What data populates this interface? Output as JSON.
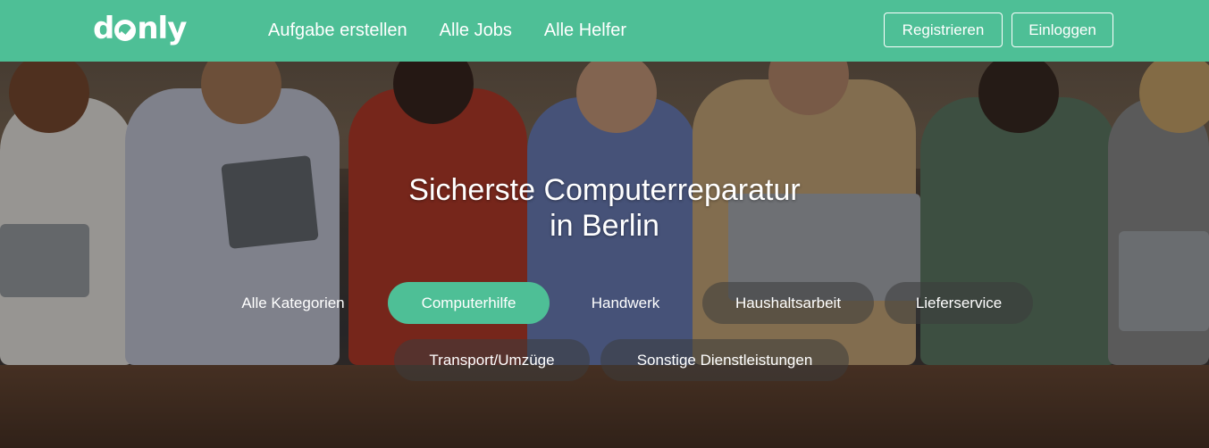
{
  "logo": {
    "text_pre": "d",
    "text_post": "nly",
    "icon": "check-circle-icon"
  },
  "nav": {
    "links": [
      "Aufgabe erstellen",
      "Alle Jobs",
      "Alle Helfer"
    ],
    "register_label": "Registrieren",
    "login_label": "Einloggen"
  },
  "hero": {
    "headline_line1": "Sicherste Computerreparatur",
    "headline_line2": "in Berlin"
  },
  "categories": [
    {
      "label": "Alle Kategorien",
      "state": "plain"
    },
    {
      "label": "Computerhilfe",
      "state": "active"
    },
    {
      "label": "Handwerk",
      "state": "plain"
    },
    {
      "label": "Haushaltsarbeit",
      "state": "dark"
    },
    {
      "label": "Lieferservice",
      "state": "dark"
    },
    {
      "label": "Transport/Umzüge",
      "state": "dark"
    },
    {
      "label": "Sonstige Dienstleistungen",
      "state": "dark"
    }
  ],
  "colors": {
    "brand": "#4ebf96",
    "text": "#ffffff"
  }
}
